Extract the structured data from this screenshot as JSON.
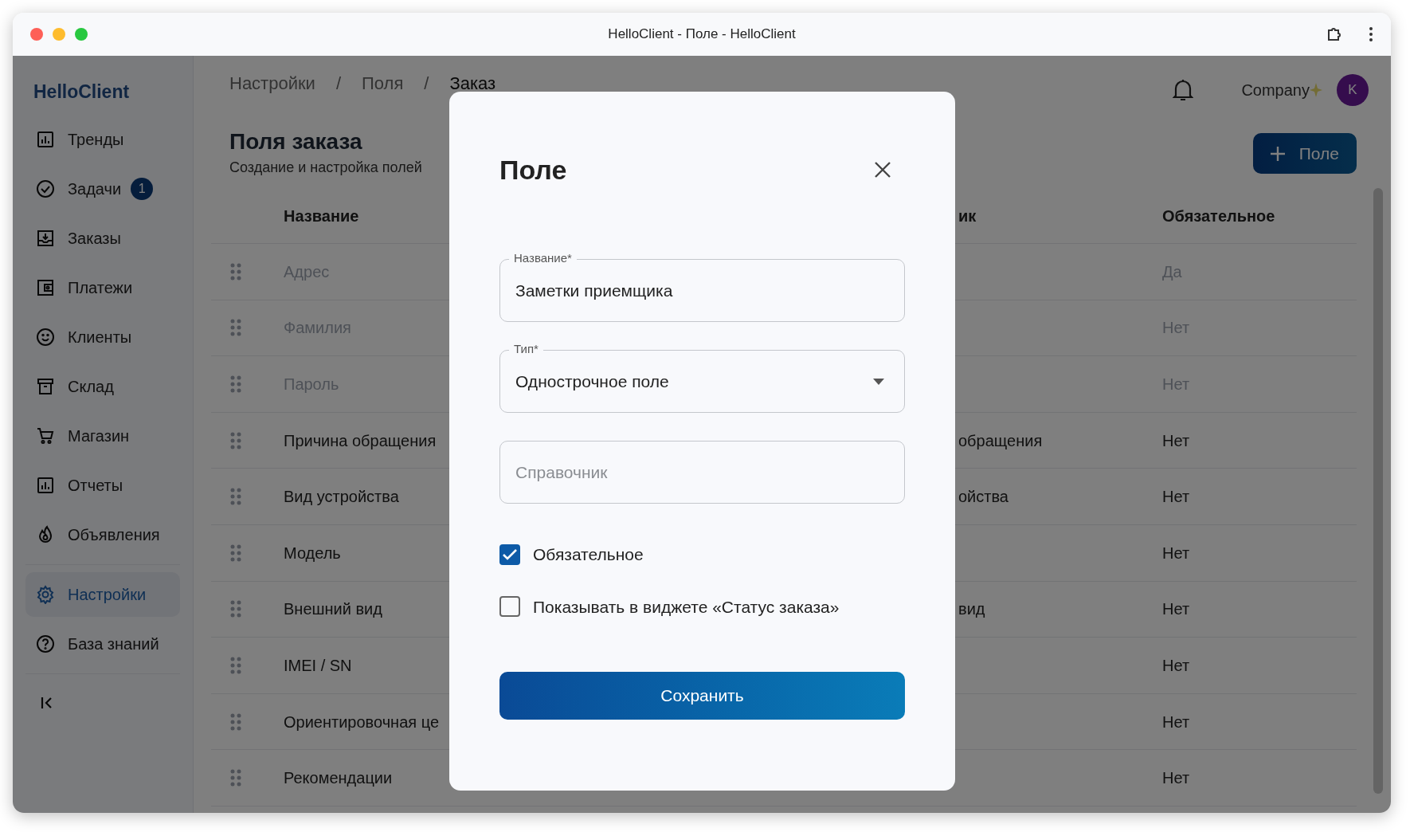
{
  "window": {
    "title": "HelloClient - Поле - HelloClient"
  },
  "sidebar": {
    "logo": "HelloClient",
    "sections": [
      [
        {
          "kind": "chart",
          "label": "Тренды",
          "selected": false
        },
        {
          "kind": "check",
          "label": "Задачи",
          "badge": "1",
          "selected": false
        },
        {
          "kind": "inbox",
          "label": "Заказы",
          "selected": false
        },
        {
          "kind": "wallet",
          "label": "Платежи",
          "selected": false
        },
        {
          "kind": "smile",
          "label": "Клиенты",
          "selected": false
        },
        {
          "kind": "archive",
          "label": "Склад",
          "selected": false
        },
        {
          "kind": "cart",
          "label": "Магазин",
          "selected": false
        },
        {
          "kind": "chart",
          "label": "Отчеты",
          "selected": false
        },
        {
          "kind": "flame",
          "label": "Объявления",
          "selected": false
        }
      ],
      [
        {
          "kind": "gear",
          "label": "Настройки",
          "selected": true
        },
        {
          "kind": "help",
          "label": "База знаний",
          "selected": false
        }
      ]
    ]
  },
  "header": {
    "breadcrumbs": [
      {
        "kind": "link",
        "text": "Настройки"
      },
      {
        "kind": "separator",
        "text": "/"
      },
      {
        "kind": "link",
        "text": "Поля"
      },
      {
        "kind": "separator",
        "text": "/"
      },
      {
        "kind": "current",
        "text": "Заказ"
      }
    ],
    "company": "Company",
    "avatar": "K"
  },
  "page": {
    "title": "Поля заказа",
    "subtitle": "Создание и настройка полей",
    "add_button": "Поле"
  },
  "table": {
    "columns": [
      "Название",
      "ик",
      "Обязательное"
    ],
    "rows": [
      {
        "name": "Адрес",
        "required": "Да",
        "disabled": true
      },
      {
        "name": "Фамилия",
        "required": "Нет",
        "disabled": true
      },
      {
        "name": "Пароль",
        "required": "Нет",
        "disabled": true
      },
      {
        "name": "Причина обращения",
        "column_3": "обращения",
        "required": "Нет",
        "disabled": false
      },
      {
        "name": "Вид устройства",
        "column_3": "ойства",
        "required": "Нет",
        "disabled": false
      },
      {
        "name": "Модель",
        "required": "Нет",
        "disabled": false
      },
      {
        "name": "Внешний вид",
        "column_3": "вид",
        "required": "Нет",
        "disabled": false
      },
      {
        "name": "IMEI / SN",
        "required": "Нет",
        "disabled": false
      },
      {
        "name": "Ориентировочная це",
        "required": "Нет",
        "disabled": false
      },
      {
        "name": "Рекомендации",
        "required": "Нет",
        "disabled": false
      }
    ]
  },
  "modal": {
    "title": "Поле",
    "fields": [
      {
        "kind": "text",
        "label": "Название*",
        "value": "Заметки приемщика"
      },
      {
        "kind": "select",
        "label": "Тип*",
        "value": "Однострочное поле"
      },
      {
        "kind": "text",
        "placeholder": "Справочник"
      }
    ],
    "checkboxes": [
      {
        "label": "Обязательное",
        "checked": true
      },
      {
        "label": "Показывать в виджете «Статус заказа»",
        "checked": false
      }
    ],
    "save_button": "Сохранить"
  }
}
